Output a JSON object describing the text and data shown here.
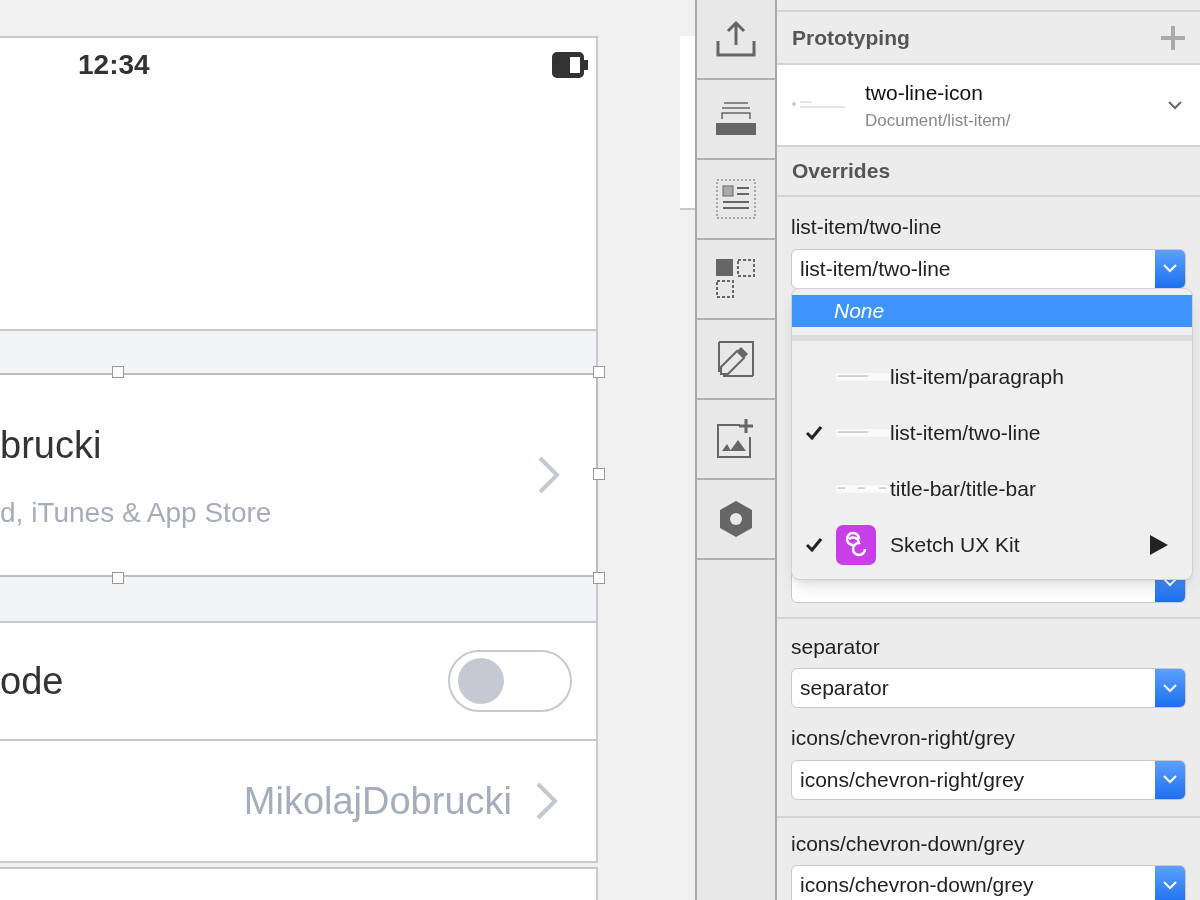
{
  "artboard": {
    "status_bar": {
      "time": "12:34"
    },
    "account_row": {
      "title": "brucki",
      "subtitle": "d, iTunes & App Store",
      "selected": true
    },
    "toggle_row": {
      "label": "ode",
      "on": false
    },
    "username_row": {
      "value": "MikolajDobrucki"
    }
  },
  "toolbar": [
    {
      "kind": "export"
    },
    {
      "kind": "stack"
    },
    {
      "kind": "text-layout"
    },
    {
      "kind": "grid"
    },
    {
      "kind": "edit"
    },
    {
      "kind": "image-add"
    },
    {
      "kind": "hexagon"
    }
  ],
  "inspector": {
    "prototyping": {
      "title": "Prototyping"
    },
    "symbol": {
      "name": "two-line-icon",
      "path": "Document/list-item/"
    },
    "overrides": {
      "title": "Overrides",
      "groups": [
        {
          "kind": "field",
          "label": "list-item/two-line",
          "value": "list-item/two-line"
        },
        {
          "kind": "covered"
        },
        {
          "kind": "field",
          "label": "separator",
          "value": "separator"
        },
        {
          "kind": "field",
          "label": "icons/chevron-right/grey",
          "value": "icons/chevron-right/grey"
        },
        {
          "kind": "field",
          "label": "icons/chevron-down/grey",
          "value": "icons/chevron-down/grey"
        }
      ]
    },
    "menu": [
      {
        "kind": "none",
        "label": "None",
        "selected": true
      },
      {
        "kind": "separator"
      },
      {
        "kind": "symbol",
        "label": "list-item/paragraph",
        "checked": false,
        "selected": false
      },
      {
        "kind": "symbol",
        "label": "list-item/two-line",
        "checked": true,
        "selected": false
      },
      {
        "kind": "symbol",
        "label": "title-bar/title-bar",
        "checked": false,
        "selected": false
      },
      {
        "kind": "library",
        "label": "Sketch UX Kit",
        "checked": true,
        "selected": false
      }
    ]
  }
}
